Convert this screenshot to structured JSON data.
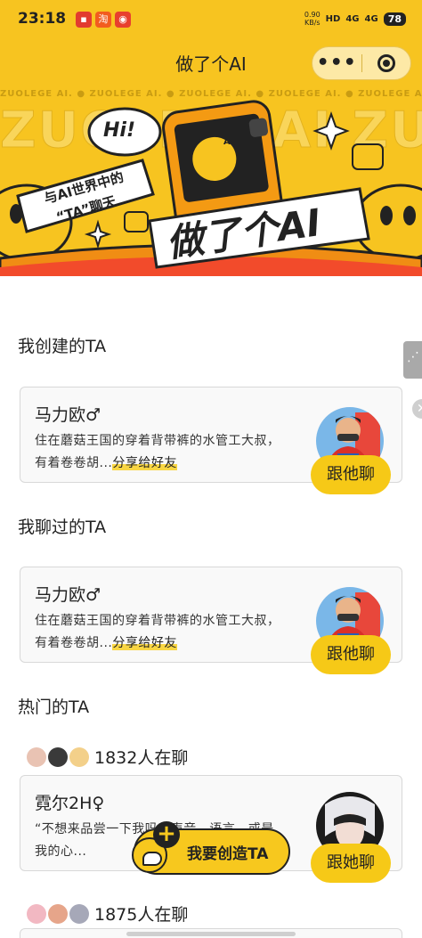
{
  "status_bar": {
    "time": "23:18",
    "net_speed_value": "0.90",
    "net_speed_unit": "KB/s",
    "hd": "HD",
    "signal1": "4G",
    "signal2": "4G",
    "battery": "78"
  },
  "nav": {
    "title": "做了个AI",
    "more_label": "•••"
  },
  "banner": {
    "watermark": "ZUOLEGE AI. ● ZUOLEGE AI. ● ZUOLEGE AI. ● ZUOLEGE AI. ● ZUOLEGE AI. ● ZUOLEGE AI. ●",
    "background_letters": "ZUOLEGEAI ZUOLEGEAI",
    "hi_text": "Hi!",
    "tagline_1": "与AI世界中的",
    "tagline_2": "“TA”聊天",
    "brand_text": "做了个AI",
    "phone_badge": "AI"
  },
  "sections": {
    "created": "我创建的TA",
    "chatted": "我聊过的TA",
    "hot": "热门的TA"
  },
  "created_card": {
    "name": "马力欧♂",
    "desc": "住在蘑菇王国的穿着背带裤的水管工大叔，有着卷卷胡...",
    "share": "分享给好友",
    "chat_button": "跟他聊"
  },
  "chatted_card": {
    "name": "马力欧♂",
    "desc": "住在蘑菇王国的穿着背带裤的水管工大叔，有着卷卷胡...",
    "share": "分享给好友",
    "chat_button": "跟他聊"
  },
  "hot_items": [
    {
      "count": "1832人在聊",
      "name": "霓尔2H♀",
      "desc": "“不想来品尝一下我吗？声音、语言，或是我的心...",
      "chat_button": "跟她聊"
    },
    {
      "count": "1875人在聊"
    }
  ],
  "create_button": {
    "plus": "+",
    "label": "我要创造TA"
  },
  "colors": {
    "brand_yellow": "#f7c420",
    "button_yellow": "#f6c917",
    "text_dark": "#222222"
  }
}
